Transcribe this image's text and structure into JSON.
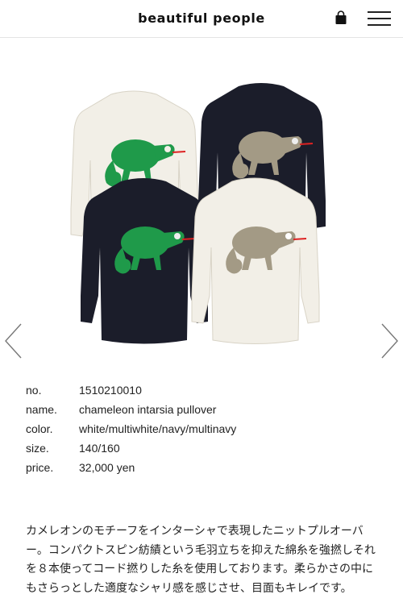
{
  "header": {
    "brand": "beautiful people"
  },
  "product": {
    "specs": [
      {
        "key": "no.",
        "value": "1510210010"
      },
      {
        "key": "name.",
        "value": "chameleon intarsia pullover"
      },
      {
        "key": "color.",
        "value": "white/multiwhite/navy/multinavy"
      },
      {
        "key": "size.",
        "value": "140/160"
      },
      {
        "key": "price.",
        "value": "32,000 yen"
      }
    ],
    "description": "カメレオンのモチーフをインターシャで表現したニットプルオーバー。コンパクトスピン紡績という毛羽立ちを抑えた綿糸を強撚しそれを８本使ってコード撚りした糸を使用しております。柔らかさの中にもさらっとした適度なシャリ感を感じさせ、目面もキレイです。"
  },
  "icons": {
    "bag": "shopping-bag-icon",
    "menu": "hamburger-menu-icon",
    "prev": "chevron-left-icon",
    "next": "chevron-right-icon"
  },
  "colors": {
    "cream_sweater": "#f3f0e8",
    "navy_sweater": "#1b1d2a",
    "green_chameleon": "#1f9a4a",
    "multi_chameleon": "#a39a85"
  }
}
